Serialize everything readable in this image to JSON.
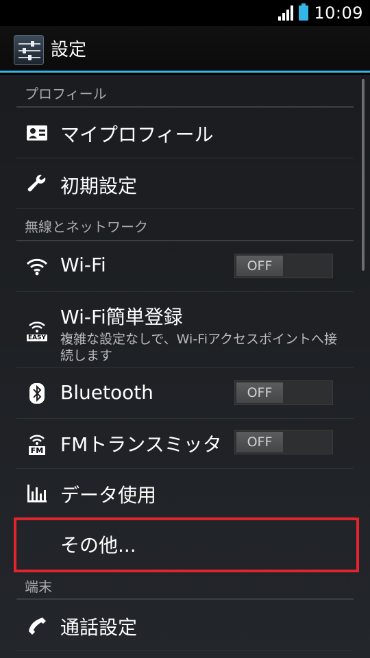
{
  "status_bar": {
    "time": "10:09",
    "icons": [
      "signal-icon",
      "battery-icon"
    ]
  },
  "action_bar": {
    "title": "設定",
    "icon": "settings-icon"
  },
  "colors": {
    "accent": "#33b5e5",
    "highlight": "#e2242c"
  },
  "sections": {
    "profile": {
      "header": "プロフィール",
      "items": [
        {
          "title": "マイプロフィール",
          "icon": "profile-card-icon"
        },
        {
          "title": "初期設定",
          "icon": "wrench-icon"
        }
      ]
    },
    "wireless": {
      "header": "無線とネットワーク",
      "items": [
        {
          "title": "Wi-Fi",
          "icon": "wifi-icon",
          "toggle": "OFF"
        },
        {
          "title": "Wi-Fi簡単登録",
          "summary": "複雑な設定なしで、Wi-Fiアクセスポイントへ接続します",
          "icon": "wifi-easy-icon",
          "icon_label": "EASY"
        },
        {
          "title": "Bluetooth",
          "icon": "bluetooth-icon",
          "toggle": "OFF"
        },
        {
          "title": "FMトランスミッタ",
          "icon": "fm-transmitter-icon",
          "icon_label": "FM",
          "toggle": "OFF"
        },
        {
          "title": "データ使用",
          "icon": "data-usage-icon"
        },
        {
          "title": "その他..."
        }
      ]
    },
    "device": {
      "header": "端末",
      "items": [
        {
          "title": "通話設定",
          "icon": "phone-icon"
        }
      ]
    }
  }
}
